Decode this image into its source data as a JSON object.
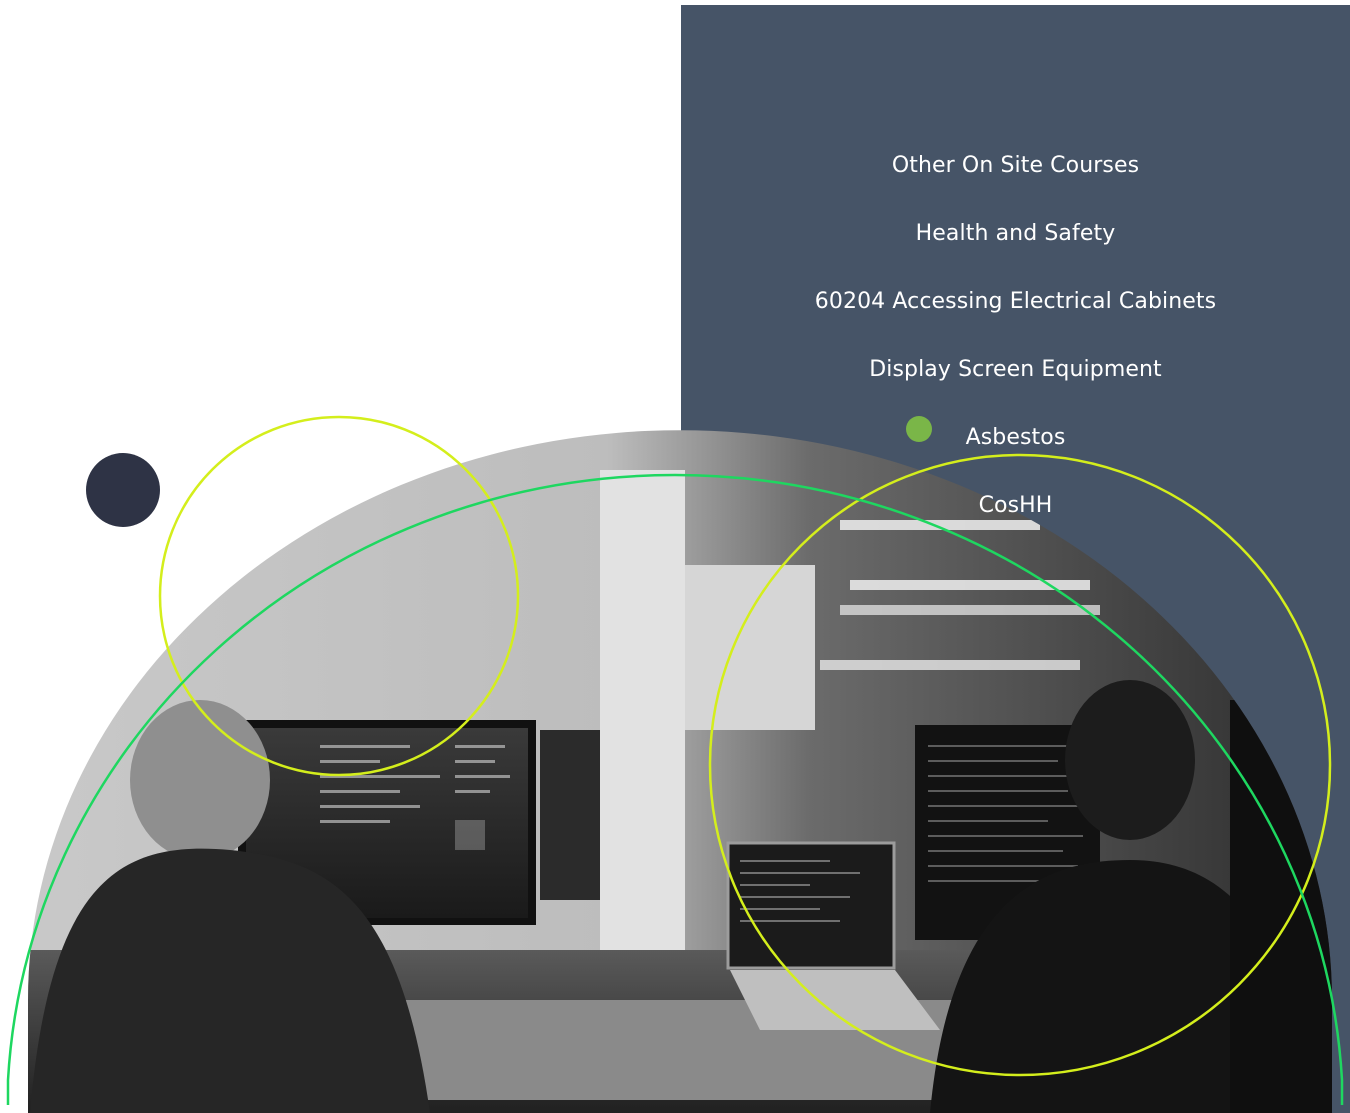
{
  "colors": {
    "panel": "#465467",
    "accent_green": "#7ab648",
    "lime": "#d4ee1c",
    "green_arc": "#1ed760",
    "navy_dot": "#2e3345",
    "background": "#ffffff"
  },
  "course_list": {
    "items": [
      "Other On Site Courses",
      "Health and Safety",
      "60204 Accessing Electrical Cabinets",
      "Display Screen Equipment",
      "Asbestos",
      "CosHH"
    ]
  },
  "photo": {
    "description_icon": "office-developers-photo"
  }
}
